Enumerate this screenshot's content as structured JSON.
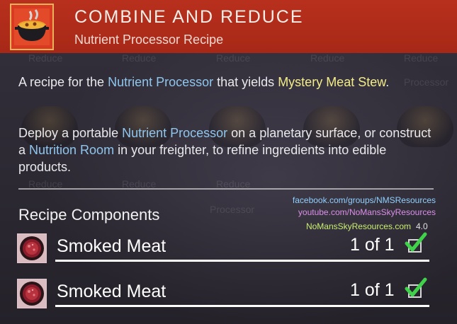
{
  "header": {
    "icon": "stew-pot-icon",
    "title": "COMBINE AND REDUCE",
    "subtitle": "Nutrient Processor Recipe",
    "color": "#b8301d"
  },
  "description": {
    "p1": {
      "a": "A recipe for the ",
      "b": "Nutrient Processor",
      "c": " that yields ",
      "d": "Mystery Meat Stew",
      "e": "."
    },
    "p2": {
      "a": "Deploy a portable ",
      "b": "Nutrient Processor",
      "c": " on a planetary surface, or construct a ",
      "d": "Nutrition Room",
      "e": " in your freighter, to refine ingredients into edible products."
    }
  },
  "background_labels": {
    "reduce": "Reduce",
    "processor": "Processor"
  },
  "section": {
    "title": "Recipe Components"
  },
  "watermark": {
    "facebook": "facebook.com/groups/NMSResources",
    "youtube": "youtube.com/NoMansSkyResources",
    "site": "NoMansSkyResources.com",
    "version": "4.0"
  },
  "components": [
    {
      "icon": "smoked-meat-icon",
      "name": "Smoked Meat",
      "count": "1 of 1",
      "complete": true
    },
    {
      "icon": "smoked-meat-icon",
      "name": "Smoked Meat",
      "count": "1 of 1",
      "complete": true
    }
  ],
  "colors": {
    "highlight_blue": "#8fc6ee",
    "highlight_yellow": "#f3ec8a",
    "check_green": "#3fd24a"
  }
}
